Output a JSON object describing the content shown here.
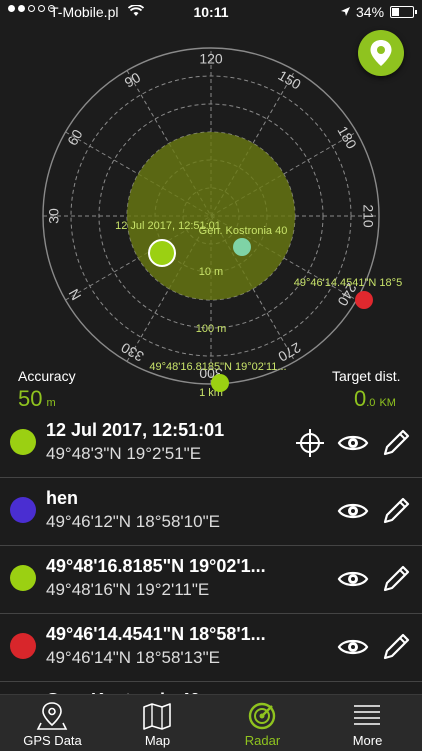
{
  "status_bar": {
    "carrier": "T-Mobile.pl",
    "time": "10:11",
    "battery": "34%"
  },
  "radar": {
    "bearings": [
      "120",
      "150",
      "180",
      "210",
      "240",
      "270",
      "300",
      "330",
      "N",
      "30",
      "60",
      "90"
    ],
    "ring_labels": [
      "10 m",
      "100 m",
      "1 km"
    ],
    "points": [
      {
        "label": "12 Jul 2017, 12:51:01",
        "color": "#9bd012"
      },
      {
        "label": "Gen. Kostronia 40",
        "color": "#7fd3a6"
      },
      {
        "label": "49°46'14.4541\"N 18°5",
        "color": "#e0282e"
      },
      {
        "label": "49°48'16.8185\"N 19°02'11...",
        "color": "#9bd012"
      }
    ]
  },
  "accuracy": {
    "label": "Accuracy",
    "value": "50",
    "unit": "m"
  },
  "target": {
    "label": "Target dist.",
    "value": "0",
    "decimal": ".0",
    "unit": "KM"
  },
  "colors": {
    "accent": "#8fc31f",
    "background": "#1c1c1c"
  },
  "list": [
    {
      "title": "12 Jul 2017, 12:51:01",
      "sub": "49°48'3\"N 19°2'51\"E",
      "color": "#9bd012",
      "crosshair": true
    },
    {
      "title": "hen",
      "sub": "49°46'12\"N 18°58'10\"E",
      "color": "#4a2ed1",
      "crosshair": false
    },
    {
      "title": "49°48'16.8185\"N 19°02'1...",
      "sub": "49°48'16\"N 19°2'11\"E",
      "color": "#9bd012",
      "crosshair": false
    },
    {
      "title": "49°46'14.4541\"N 18°58'1...",
      "sub": "49°46'14\"N 18°58'13\"E",
      "color": "#d8262b",
      "crosshair": false
    }
  ],
  "partial_item": "Gen. Kostronia 40",
  "tabs": [
    {
      "label": "GPS Data",
      "icon": "map-pin-icon"
    },
    {
      "label": "Map",
      "icon": "folded-map-icon"
    },
    {
      "label": "Radar",
      "icon": "radar-icon",
      "active": true
    },
    {
      "label": "More",
      "icon": "list-icon"
    }
  ]
}
